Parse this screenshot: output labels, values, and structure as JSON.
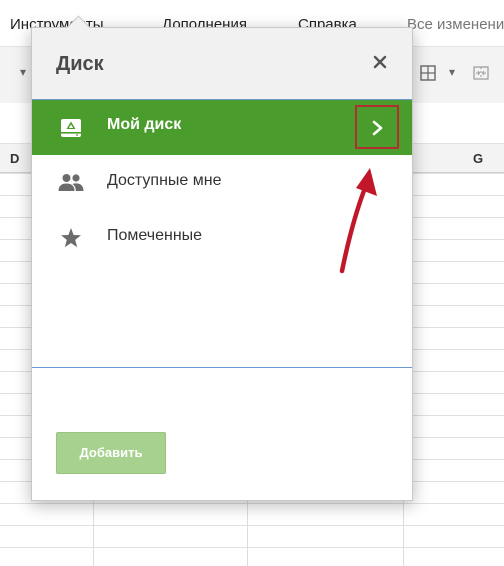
{
  "menubar": {
    "items": [
      "Инструменты",
      "Дополнения",
      "Справка"
    ],
    "status": "Все изменения"
  },
  "grid": {
    "col_headers": [
      "D",
      "G"
    ]
  },
  "dialog": {
    "title": "Диск",
    "close_glyph": "×",
    "nav_items": [
      {
        "label": "Мой диск",
        "icon": "drive-icon",
        "active": true
      },
      {
        "label": "Доступные мне",
        "icon": "people-icon",
        "active": false
      },
      {
        "label": "Помеченные",
        "icon": "star-icon",
        "active": false
      }
    ],
    "add_button_label": "Добавить"
  },
  "colors": {
    "active_green": "#4a9d2c",
    "add_button": "#a6d18f",
    "highlight_red": "#b03030",
    "arrow_red": "#c0182a",
    "divider_blue": "#6a98cf"
  }
}
